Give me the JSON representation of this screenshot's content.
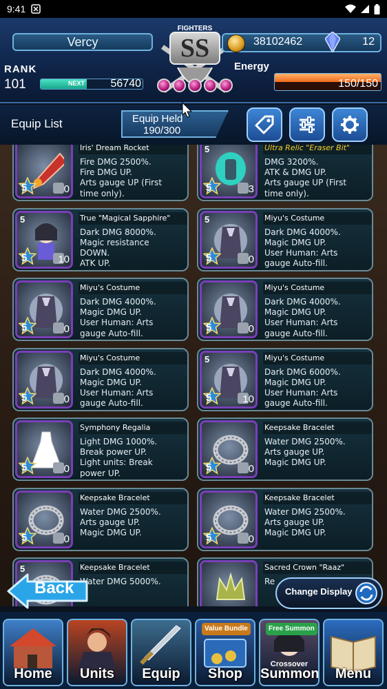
{
  "status_bar": {
    "time": "9:41"
  },
  "player": {
    "name": "Vercy",
    "rank_label": "RANK",
    "rank": "101",
    "next_label": "NEXT",
    "next_exp": "56740",
    "exp_progress": 0.45,
    "money": "38102462",
    "gems": "12",
    "energy_label": "Energy",
    "energy": "150/150",
    "energy_fraction": 1.0
  },
  "emblem": {
    "line1": "FIGHTERS",
    "line2": "SS"
  },
  "subheader": {
    "title": "Equip List",
    "held_label": "Equip Held",
    "held_value": "190/300"
  },
  "cards": [
    {
      "title": "Iris' Dream Rocket",
      "relic": false,
      "lines": [
        "Fire DMG 2500%.",
        "Fire DMG UP.",
        "Arts gauge UP (First",
        "time only)."
      ],
      "stars": "5",
      "count": "0",
      "limit": "",
      "icon": "rocket-icon"
    },
    {
      "title": "Ultra Relic \"Eraser Bit\"",
      "relic": true,
      "lines": [
        "DMG 3200%.",
        "ATK & DMG UP.",
        "Arts gauge UP (First",
        "time only)."
      ],
      "stars": "5",
      "count": "3",
      "limit": "5",
      "icon": "eraser-bit-icon"
    },
    {
      "title": "True \"Magical Sapphire\"",
      "relic": false,
      "lines": [
        "Dark DMG 8000%.",
        "Magic resistance",
        "DOWN.",
        "ATK UP."
      ],
      "stars": "5",
      "count": "10",
      "limit": "5",
      "icon": "magical-girl-icon"
    },
    {
      "title": "Miyu's Costume",
      "relic": false,
      "lines": [
        "Dark DMG 4000%.",
        "Magic DMG UP.",
        "User Human: Arts",
        "gauge Auto-fill."
      ],
      "stars": "5",
      "count": "0",
      "limit": "5",
      "icon": "costume-icon"
    },
    {
      "title": "Miyu's Costume",
      "relic": false,
      "lines": [
        "Dark DMG 4000%.",
        "Magic DMG UP.",
        "User Human: Arts",
        "gauge Auto-fill."
      ],
      "stars": "5",
      "count": "0",
      "limit": "",
      "icon": "costume-icon"
    },
    {
      "title": "Miyu's Costume",
      "relic": false,
      "lines": [
        "Dark DMG 4000%.",
        "Magic DMG UP.",
        "User Human: Arts",
        "gauge Auto-fill."
      ],
      "stars": "5",
      "count": "0",
      "limit": "",
      "icon": "costume-icon"
    },
    {
      "title": "Miyu's Costume",
      "relic": false,
      "lines": [
        "Dark DMG 4000%.",
        "Magic DMG UP.",
        "User Human: Arts",
        "gauge Auto-fill."
      ],
      "stars": "5",
      "count": "0",
      "limit": "",
      "icon": "costume-icon"
    },
    {
      "title": "Miyu's Costume",
      "relic": false,
      "lines": [
        "Dark DMG 6000%.",
        "Magic DMG UP.",
        "User Human: Arts",
        "gauge Auto-fill."
      ],
      "stars": "5",
      "count": "10",
      "limit": "5",
      "icon": "costume-icon"
    },
    {
      "title": "Symphony Regalia",
      "relic": false,
      "lines": [
        "Light DMG 1000%.",
        "Break power UP.",
        "Light units: Break",
        "power UP."
      ],
      "stars": "5",
      "count": "0",
      "limit": "",
      "icon": "dress-icon"
    },
    {
      "title": "Keepsake Bracelet",
      "relic": false,
      "lines": [
        "Water DMG 2500%.",
        "Arts gauge UP.",
        "Magic DMG UP."
      ],
      "stars": "5",
      "count": "0",
      "limit": "",
      "icon": "bracelet-icon"
    },
    {
      "title": "Keepsake Bracelet",
      "relic": false,
      "lines": [
        "Water DMG 2500%.",
        "Arts gauge UP.",
        "Magic DMG UP."
      ],
      "stars": "5",
      "count": "0",
      "limit": "",
      "icon": "bracelet-icon"
    },
    {
      "title": "Keepsake Bracelet",
      "relic": false,
      "lines": [
        "Water DMG 2500%.",
        "Arts gauge UP.",
        "Magic DMG UP."
      ],
      "stars": "5",
      "count": "0",
      "limit": "",
      "icon": "bracelet-icon"
    },
    {
      "title": "Keepsake Bracelet",
      "relic": false,
      "lines": [
        "Water DMG 5000%."
      ],
      "stars": "",
      "count": "",
      "limit": "5",
      "icon": "bracelet-icon"
    },
    {
      "title": "Sacred Crown \"Raaz\"",
      "relic": false,
      "lines": [
        "Re"
      ],
      "stars": "",
      "count": "",
      "limit": "",
      "icon": "crown-icon"
    }
  ],
  "buttons": {
    "back": "Back",
    "change_display": "Change Display"
  },
  "nav": [
    {
      "label": "Home",
      "badge": "",
      "sub": "",
      "color": "#3f7fc8",
      "icon": "home-icon"
    },
    {
      "label": "Units",
      "badge": "",
      "sub": "",
      "color": "#b84422",
      "icon": "units-icon"
    },
    {
      "label": "Equip",
      "badge": "",
      "sub": "",
      "color": "#3d6c8e",
      "icon": "sword-icon"
    },
    {
      "label": "Shop",
      "badge": "Value Bundle",
      "sub": "",
      "color": "#2a5aa0",
      "icon": "shop-icon"
    },
    {
      "label": "Summon",
      "badge": "Free Summon",
      "sub": "Crossover",
      "color": "#5a4a66",
      "icon": "summon-icon"
    },
    {
      "label": "Menu",
      "badge": "",
      "sub": "",
      "color": "#2c6cbf",
      "icon": "book-icon"
    }
  ],
  "colors": {
    "accent": "#6fb2e0",
    "relic_title": "#f7d02d",
    "frame_purple": "#7a3fb8",
    "energy": "#f06a1a",
    "exp": "#4ae3c4"
  }
}
